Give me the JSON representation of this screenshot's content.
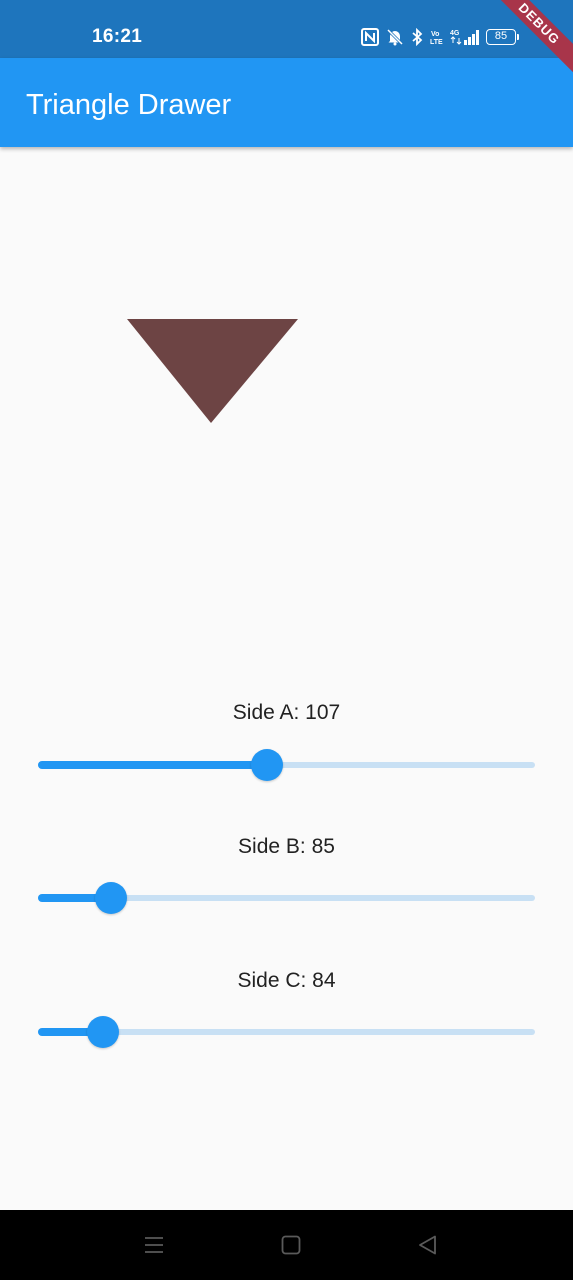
{
  "status_bar": {
    "time": "16:21",
    "battery": "85",
    "network": "4G",
    "icons": [
      "nfc-icon",
      "mute-bell-icon",
      "bluetooth-icon",
      "volte-icon",
      "signal-icon",
      "battery-icon"
    ]
  },
  "debug_banner": "DEBUG",
  "app_bar": {
    "title": "Triangle Drawer"
  },
  "triangle": {
    "fill": "#6d4444",
    "orientation": "inverted"
  },
  "sliders": [
    {
      "label": "Side A: 107",
      "value": 107,
      "fraction": 0.46
    },
    {
      "label": "Side B: 85",
      "value": 85,
      "fraction": 0.146
    },
    {
      "label": "Side C: 84",
      "value": 84,
      "fraction": 0.13
    }
  ],
  "colors": {
    "primary": "#2196f3",
    "status_bar": "#1e75bd",
    "track_inactive": "#c8e0f4",
    "background": "#fafafa",
    "debug": "#a8354a"
  },
  "nav_bar": {
    "buttons": [
      "menu-icon",
      "home-icon",
      "back-icon"
    ]
  }
}
